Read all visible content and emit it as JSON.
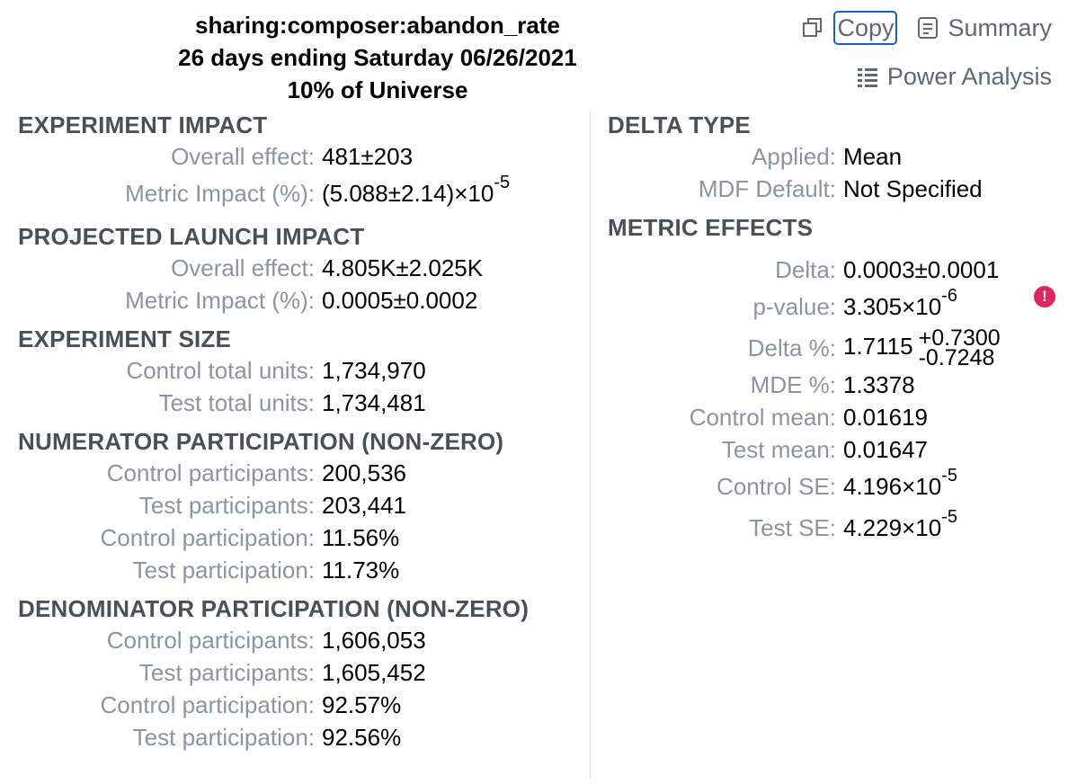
{
  "header": {
    "metric": "sharing:composer:abandon_rate",
    "period": "26 days ending Saturday 06/26/2021",
    "universe": "10% of Universe"
  },
  "actions": {
    "copy": "Copy",
    "summary": "Summary",
    "power_analysis": "Power Analysis"
  },
  "experiment_impact": {
    "title": "EXPERIMENT IMPACT",
    "overall_label": "Overall effect:",
    "overall_value": "481±203",
    "metric_label": "Metric Impact (%):",
    "metric_mantissa": "(5.088±2.14)×10",
    "metric_exp": "-5"
  },
  "projected_launch_impact": {
    "title": "PROJECTED LAUNCH IMPACT",
    "overall_label": "Overall effect:",
    "overall_value": "4.805K±2.025K",
    "metric_label": "Metric Impact (%):",
    "metric_value": "0.0005±0.0002"
  },
  "experiment_size": {
    "title": "EXPERIMENT SIZE",
    "control_label": "Control total units:",
    "control_value": "1,734,970",
    "test_label": "Test total units:",
    "test_value": "1,734,481"
  },
  "numerator_participation": {
    "title": "NUMERATOR PARTICIPATION (NON-ZERO)",
    "rows": [
      {
        "label": "Control participants:",
        "value": "200,536"
      },
      {
        "label": "Test participants:",
        "value": "203,441"
      },
      {
        "label": "Control participation:",
        "value": "11.56%"
      },
      {
        "label": "Test participation:",
        "value": "11.73%"
      }
    ]
  },
  "denominator_participation": {
    "title": "DENOMINATOR PARTICIPATION (NON-ZERO)",
    "rows": [
      {
        "label": "Control participants:",
        "value": "1,606,053"
      },
      {
        "label": "Test participants:",
        "value": "1,605,452"
      },
      {
        "label": "Control participation:",
        "value": "92.57%"
      },
      {
        "label": "Test participation:",
        "value": "92.56%"
      }
    ]
  },
  "delta_type": {
    "title": "DELTA TYPE",
    "applied_label": "Applied:",
    "applied_value": "Mean",
    "mdf_label": "MDF Default:",
    "mdf_value": "Not Specified",
    "warning_icon": "!"
  },
  "metric_effects": {
    "title": "METRIC EFFECTS",
    "delta_label": "Delta:",
    "delta_value": "0.0003±0.0001",
    "pvalue_label": "p-value:",
    "pvalue_mantissa": "3.305×10",
    "pvalue_exp": "-6",
    "delta_pct_label": "Delta %:",
    "delta_pct_value": "1.7115",
    "delta_pct_upper": "+0.7300",
    "delta_pct_lower": "-0.7248",
    "mde_label": "MDE %:",
    "mde_value": "1.3378",
    "control_mean_label": "Control mean:",
    "control_mean_value": "0.01619",
    "test_mean_label": "Test mean:",
    "test_mean_value": "0.01647",
    "control_se_label": "Control SE:",
    "control_se_mantissa": "4.196×10",
    "control_se_exp": "-5",
    "test_se_label": "Test SE:",
    "test_se_mantissa": "4.229×10",
    "test_se_exp": "-5"
  },
  "colors": {
    "accent": "#1a5fd1",
    "warning": "#e0245e",
    "label": "#8d949e",
    "section": "#4b4f56"
  }
}
